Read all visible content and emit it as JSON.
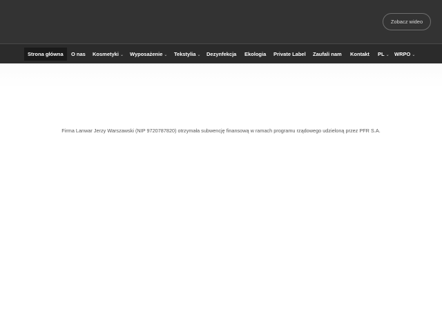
{
  "header": {
    "video_button_label": "Zobacz wideo"
  },
  "nav": {
    "items": [
      {
        "label": "Strona główna",
        "active": true,
        "dropdown": false
      },
      {
        "label": "O nas",
        "active": false,
        "dropdown": false
      },
      {
        "label": "Kosmetyki",
        "active": false,
        "dropdown": true
      },
      {
        "label": "Wyposażenie",
        "active": false,
        "dropdown": true
      },
      {
        "label": "Tekstylia",
        "active": false,
        "dropdown": true
      },
      {
        "label": "Dezynfekcja",
        "active": false,
        "dropdown": false
      },
      {
        "label": "Ekologia",
        "active": false,
        "dropdown": false
      },
      {
        "label": "Private Label",
        "active": false,
        "dropdown": false
      },
      {
        "label": "Zaufali nam",
        "active": false,
        "dropdown": false
      },
      {
        "label": "Kontakt",
        "active": false,
        "dropdown": false
      },
      {
        "label": "PL",
        "active": false,
        "dropdown": true
      },
      {
        "label": "WRPO",
        "active": false,
        "dropdown": true
      }
    ],
    "chevron_icon": "chevron-down-icon"
  },
  "main": {
    "notice_text": "Firma Lanwar Jerzy Warszawski (NIP 9720787820) otrzymała subwencję finansową w ramach programu rządowego udzieloną przez PFR S.A."
  },
  "colors": {
    "topbar": "#333333",
    "navbar": "#2b2b2b",
    "active_item": "#1a1a1a"
  }
}
